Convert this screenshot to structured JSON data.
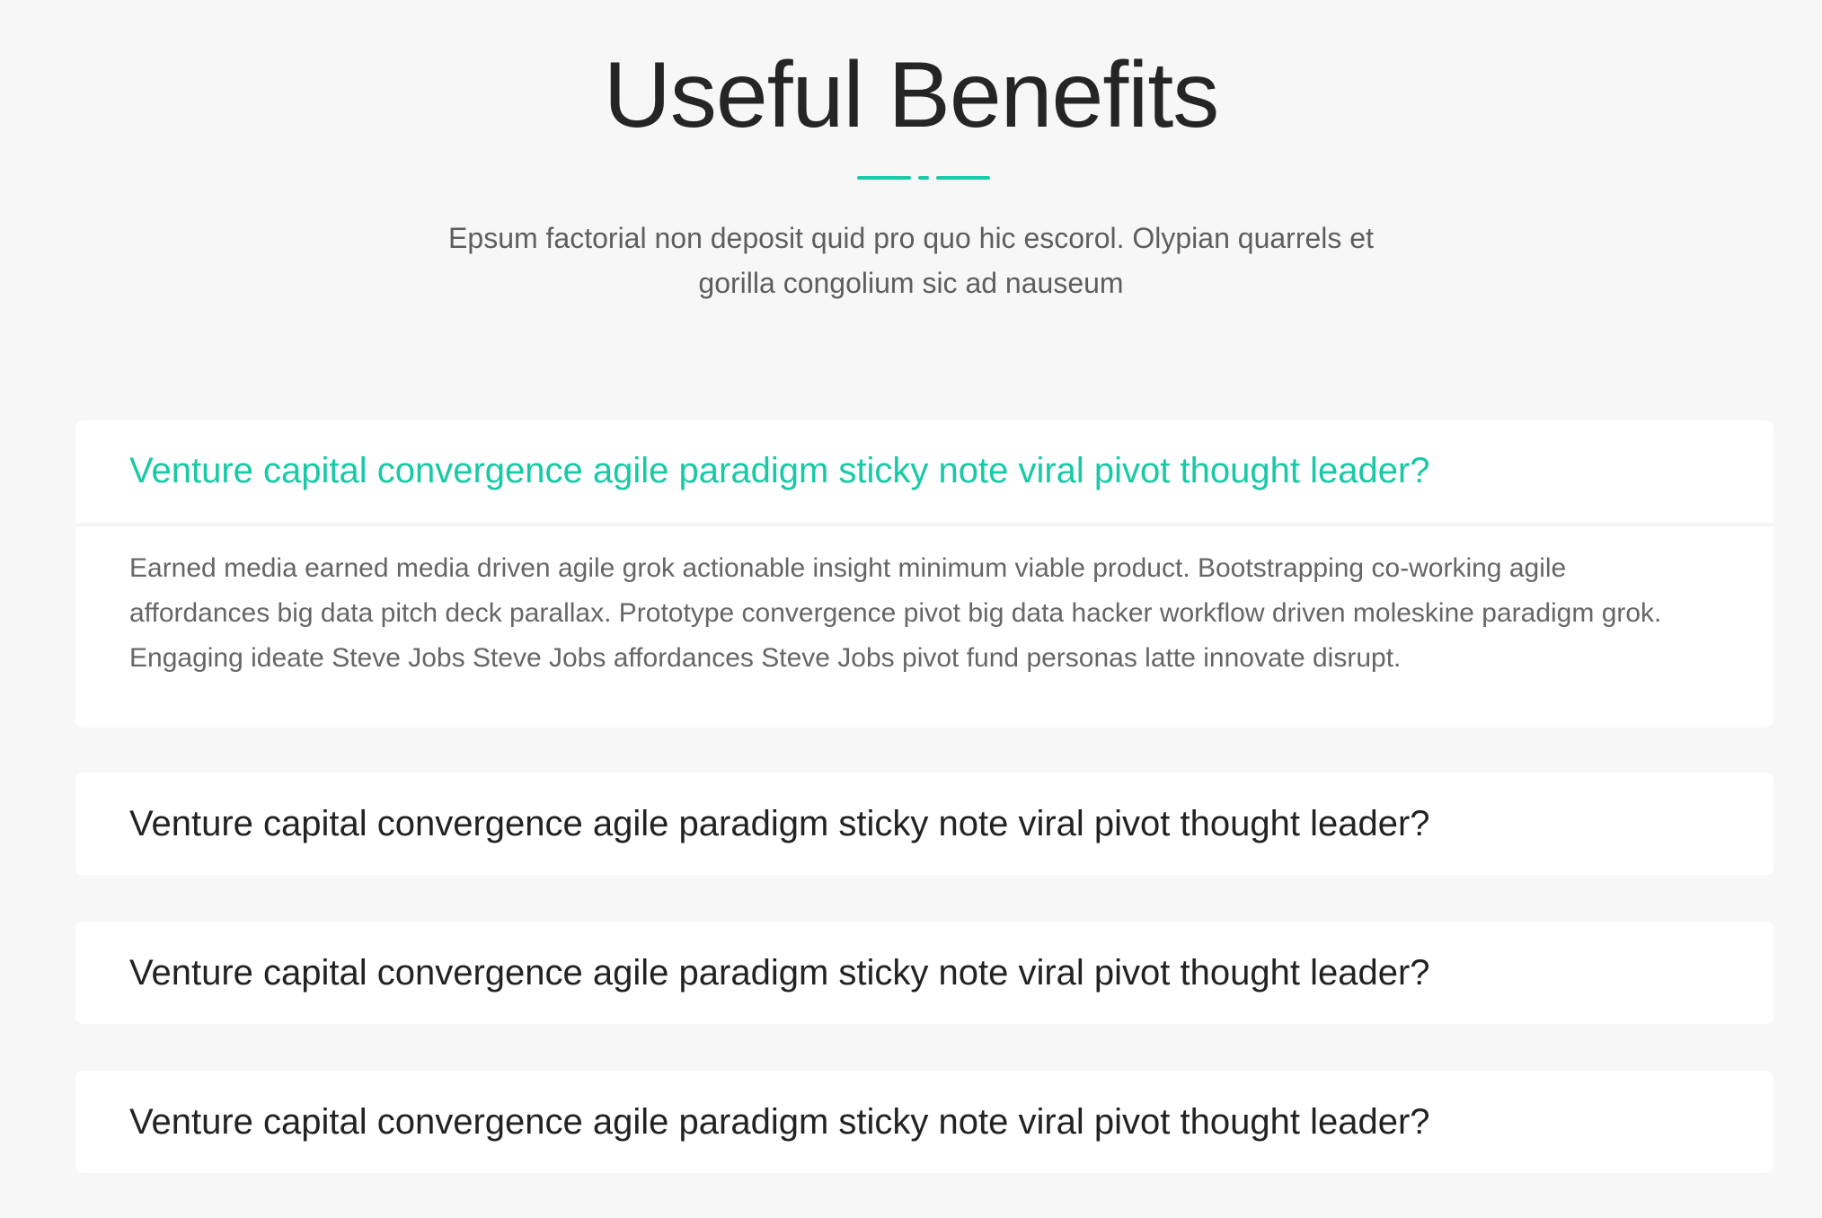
{
  "section": {
    "title": "Useful Benefits",
    "intro_line1": "Epsum factorial non deposit quid pro quo hic escorol. Olypian quarrels et",
    "intro_line2": "gorilla congolium sic ad nauseum"
  },
  "faq": {
    "items": [
      {
        "question": "Venture capital convergence agile paradigm sticky note viral pivot thought leader?",
        "expanded": true,
        "answer": "Earned media earned media driven agile grok actionable insight minimum viable product. Bootstrapping co-working agile affordances big data pitch deck parallax. Prototype convergence pivot big data hacker workflow driven moleskine paradigm grok. Engaging ideate Steve Jobs Steve Jobs affordances Steve Jobs pivot fund personas latte innovate disrupt."
      },
      {
        "question": "Venture capital convergence agile paradigm sticky note viral pivot thought leader?",
        "expanded": false
      },
      {
        "question": "Venture capital convergence agile paradigm sticky note viral pivot thought leader?",
        "expanded": false
      },
      {
        "question": "Venture capital convergence agile paradigm sticky note viral pivot thought leader?",
        "expanded": false
      }
    ]
  },
  "colors": {
    "accent": "#18c9a6",
    "background": "#f7f7f7",
    "card": "#ffffff",
    "heading": "#252525",
    "body_text": "#666666"
  }
}
